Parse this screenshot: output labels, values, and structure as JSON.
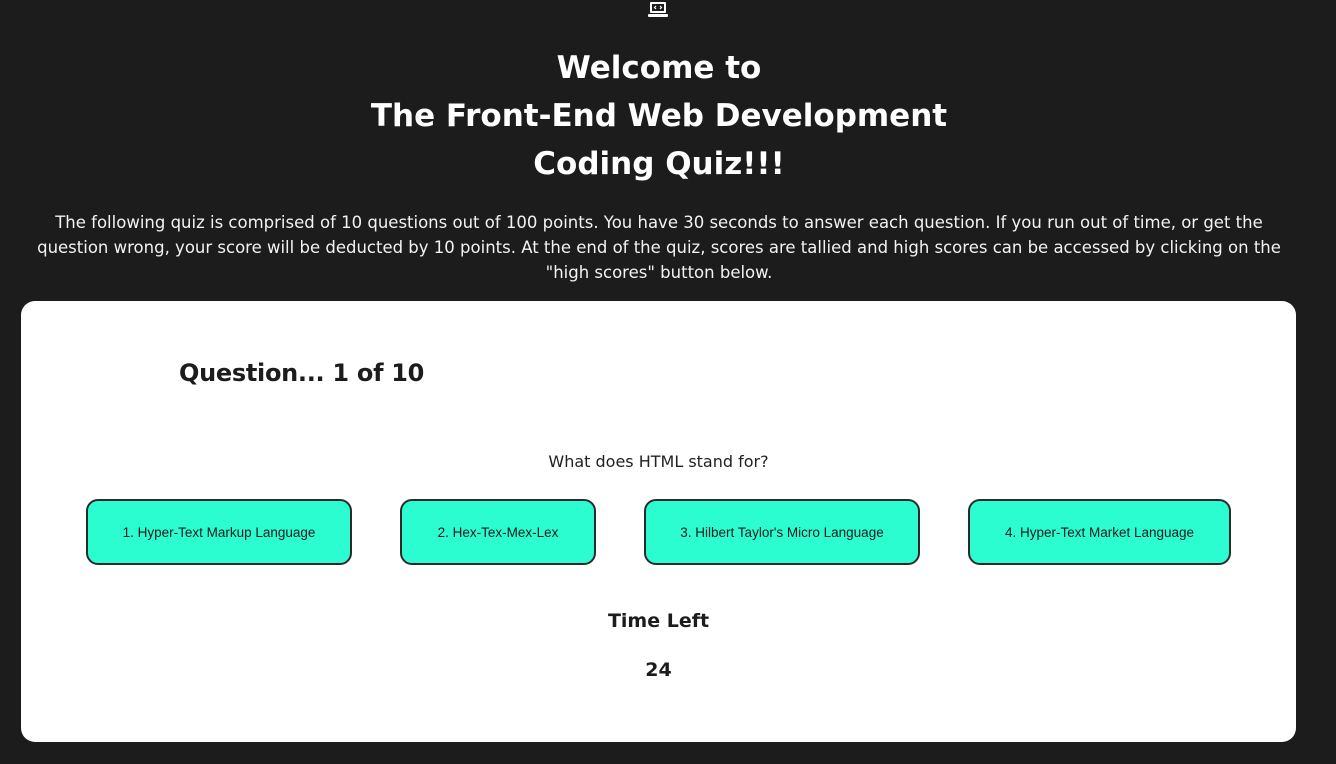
{
  "header": {
    "logo_icon": "laptop-code-icon",
    "title_lines": [
      "Welcome to",
      "The Front-End Web Development",
      "Coding Quiz!!!"
    ],
    "intro": "The following quiz is comprised of 10 questions out of 100 points. You have 30 seconds to answer each question. If you run out of time, or get the question wrong, your score will be deducted by 10 points. At the end of the quiz, scores are tallied and high scores can be accessed by clicking on the \"high scores\" button below."
  },
  "quiz": {
    "counter": "Question... 1 of 10",
    "question": "What does HTML stand for?",
    "answers": [
      "1. Hyper-Text Markup Language",
      "2. Hex-Tex-Mex-Lex",
      "3. Hilbert Taylor's Micro Language",
      "4. Hyper-Text Market Language"
    ],
    "timer_label": "Time Left",
    "timer_value": "24"
  },
  "colors": {
    "background": "#1c1c1c",
    "card": "#ffffff",
    "answer_button": "#2bfdd1"
  }
}
